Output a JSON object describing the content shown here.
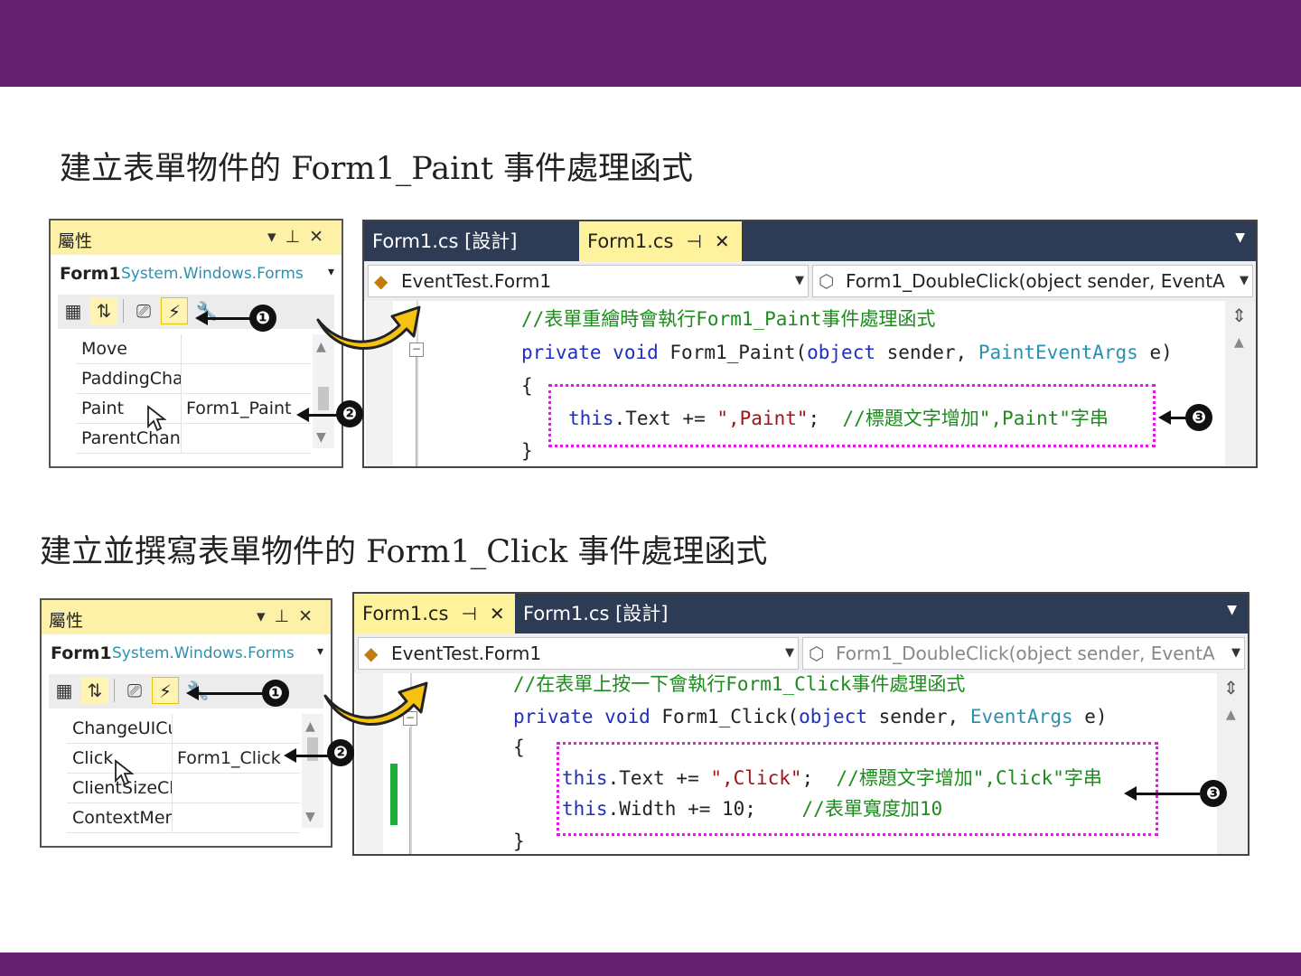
{
  "colors": {
    "banner": "#67226f",
    "tab_active": "#fff29d",
    "tab_bar": "#2e3b55",
    "keyword": "#1e2fbd",
    "type": "#2b91af",
    "comment": "#1c8c1c",
    "highlight_box": "#e01ce0"
  },
  "section1": {
    "heading": "建立表單物件的 Form1_Paint 事件處理函式",
    "properties": {
      "title": "屬性",
      "object_name": "Form1",
      "object_type": "System.Windows.Forms",
      "rows": [
        {
          "key": "Move",
          "value": ""
        },
        {
          "key": "PaddingCha",
          "value": ""
        },
        {
          "key": "Paint",
          "value": "Form1_Paint"
        },
        {
          "key": "ParentChan",
          "value": ""
        }
      ]
    },
    "editor": {
      "tab_design": "Form1.cs [設計]",
      "tab_code": "Form1.cs",
      "class_combo": "EventTest.Form1",
      "member_combo": "Form1_DoubleClick(object sender, EventA",
      "comment": "//表單重繪時會執行Form1_Paint事件處理函式",
      "sig_private": "private",
      "sig_void": "void",
      "sig_name": "Form1_Paint(",
      "sig_object": "object",
      "sig_sender": "sender,",
      "sig_argtype": "PaintEventArgs",
      "sig_end": "e)",
      "brace_open": "{",
      "brace_close": "}",
      "line1_this": "this",
      "line1_code": ".Text += ",
      "line1_str": "\",Paint\"",
      "line1_semi": ";",
      "line1_comment": "//標題文字增加\",Paint\"字串"
    },
    "badges": [
      "❶",
      "❷",
      "❸"
    ]
  },
  "section2": {
    "heading": "建立並撰寫表單物件的 Form1_Click 事件處理函式",
    "properties": {
      "title": "屬性",
      "object_name": "Form1",
      "object_type": "System.Windows.Forms",
      "rows": [
        {
          "key": "ChangeUICu",
          "value": ""
        },
        {
          "key": "Click",
          "value": "Form1_Click"
        },
        {
          "key": "ClientSizeCh",
          "value": ""
        },
        {
          "key": "ContextMen",
          "value": ""
        }
      ]
    },
    "editor": {
      "tab_code": "Form1.cs",
      "tab_design": "Form1.cs [設計]",
      "class_combo": "EventTest.Form1",
      "member_combo": "Form1_DoubleClick(object sender, EventA",
      "comment": "//在表單上按一下會執行Form1_Click事件處理函式",
      "sig_private": "private",
      "sig_void": "void",
      "sig_name": "Form1_Click(",
      "sig_object": "object",
      "sig_sender": "sender,",
      "sig_argtype": "EventArgs",
      "sig_end": "e)",
      "brace_open": "{",
      "brace_close": "}",
      "line1_this": "this",
      "line1_code": ".Text += ",
      "line1_str": "\",Click\"",
      "line1_semi": ";",
      "line1_comment": "//標題文字增加\",Click\"字串",
      "line2_this": "this",
      "line2_code": ".Width += 10;",
      "line2_comment": "//表單寬度加10"
    },
    "badges": [
      "❶",
      "❷",
      "❸"
    ]
  },
  "icons": [
    "categorized-icon",
    "alphabetical-icon",
    "property-pages-icon",
    "events-icon",
    "wrench-icon",
    "pin-icon",
    "close-icon",
    "dropdown-icon",
    "class-icon",
    "method-icon",
    "split-icon",
    "cursor-icon",
    "curved-arrow-icon"
  ]
}
